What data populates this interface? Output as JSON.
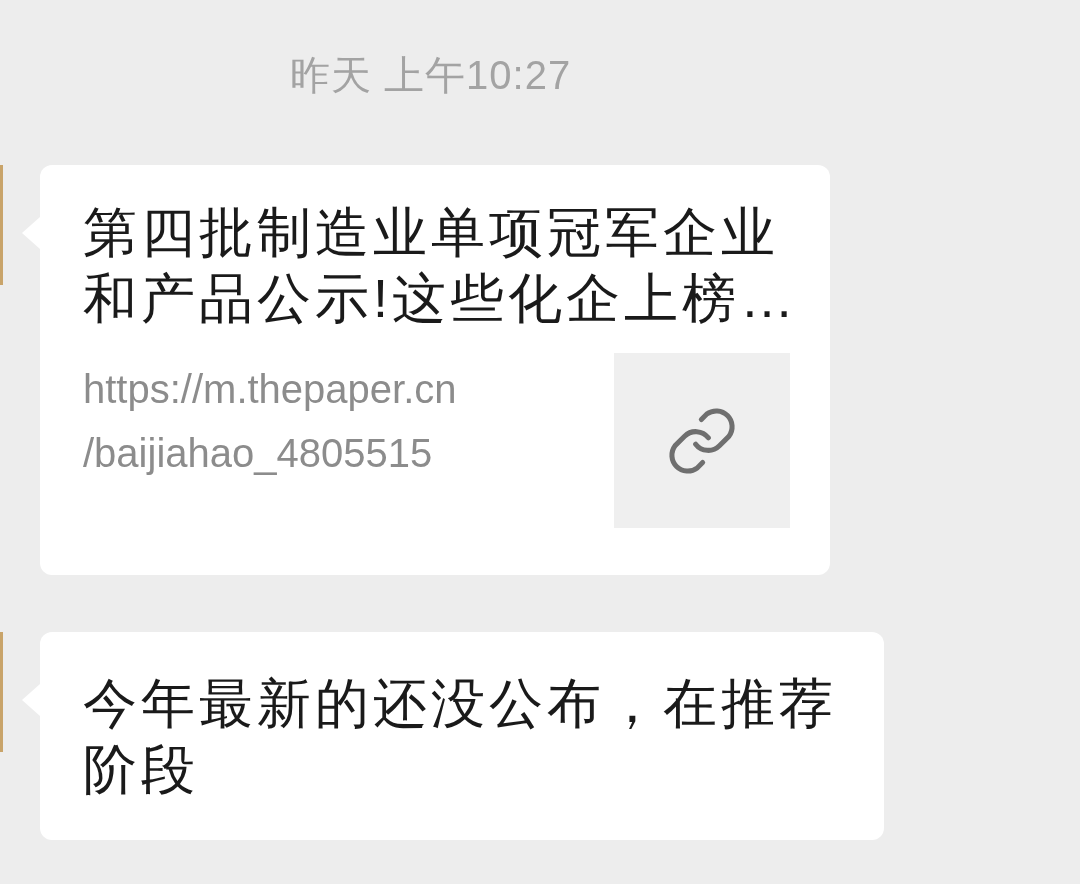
{
  "timestamp": "昨天 上午10:27",
  "messages": [
    {
      "kind": "link",
      "title": "第四批制造业单项冠军企业和产品公示!这些化企上榜…",
      "link_lines": [
        "https://m.thepaper.cn",
        "/baijiahao_4805515"
      ]
    },
    {
      "kind": "text",
      "text": "今年最新的还没公布，在推荐阶段"
    }
  ]
}
